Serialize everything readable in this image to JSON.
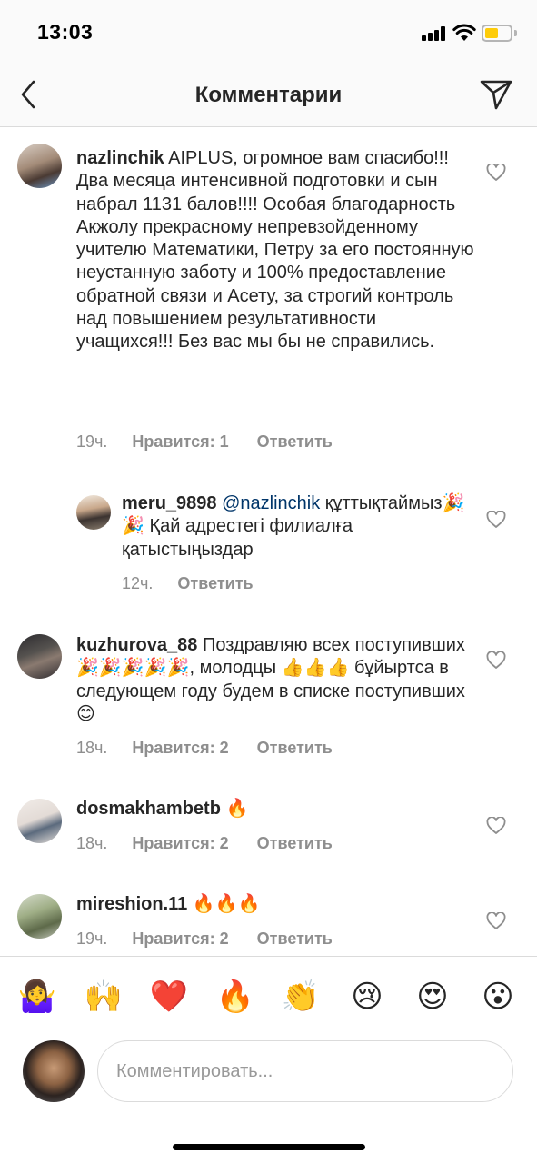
{
  "status_bar": {
    "time": "13:03"
  },
  "header": {
    "title": "Комментарии",
    "back_icon": "chevron-left-icon",
    "share_icon": "direct-send-icon"
  },
  "comments": [
    {
      "user": "nazlinchik",
      "text": "AIPLUS, огромное вам спасибо!!! Два месяца интенсивной подготовки и сын набрал 1131 балов!!!! Особая благодарность Акжолу прекрасному непревзойденному учителю Математики, Петру за его постоянную неустанную заботу и 100% предоставление обратной связи и Асету, за строгий контроль над повышением результативности учащихся!!! Без вас мы бы не справились.",
      "time": "19ч.",
      "likes": "Нравится: 1",
      "reply": "Ответить"
    },
    {
      "user": "meru_9898",
      "mention": "@nazlinchik",
      "text": "құттықтаймыз🎉🎉 Қай адрестегі филиалға қатыстыңыздар",
      "time": "12ч.",
      "reply": "Ответить"
    },
    {
      "user": "kuzhurova_88",
      "text": "Поздравляю всех поступивших🎉🎉🎉🎉🎉, молодцы 👍👍👍 бұйыртса в следующем году будем в списке поступивших😊",
      "time": "18ч.",
      "likes": "Нравится: 2",
      "reply": "Ответить"
    },
    {
      "user": "dosmakhambetb",
      "text": "🔥",
      "time": "18ч.",
      "likes": "Нравится: 2",
      "reply": "Ответить"
    },
    {
      "user": "mireshion.11",
      "text": "🔥🔥🔥",
      "time": "19ч.",
      "likes": "Нравится: 2",
      "reply": "Ответить"
    }
  ],
  "emoji_bar": [
    "🤷‍♀️",
    "🙌",
    "❤️",
    "🔥",
    "👏",
    "😢",
    "😍",
    "😮"
  ],
  "composer": {
    "placeholder": "Комментировать..."
  },
  "colors": {
    "text": "#262626",
    "meta": "#8e8e8e",
    "mention": "#003569",
    "divider": "#dbdbdb",
    "header_bg": "#fafafa"
  }
}
